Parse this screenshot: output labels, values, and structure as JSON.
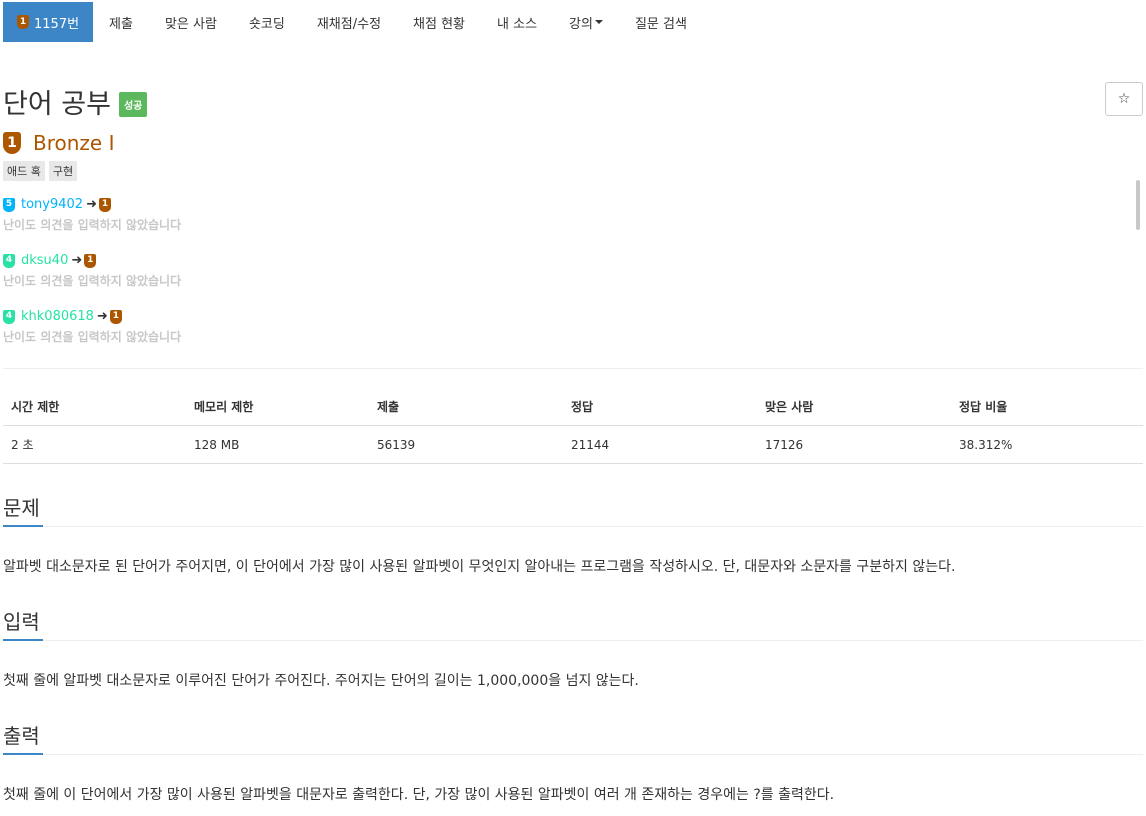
{
  "nav": {
    "problem_id": "1157번",
    "items": [
      "제출",
      "맞은 사람",
      "숏코딩",
      "재채점/수정",
      "채점 현황",
      "내 소스",
      "강의",
      "질문 검색"
    ]
  },
  "problem": {
    "title": "단어 공부",
    "result_label": "성공",
    "star": "☆",
    "tier_num": "1",
    "tier_name": "Bronze I",
    "tags": [
      "애드 혹",
      "구현"
    ]
  },
  "opinions": [
    {
      "from_tier": "5",
      "user": "tony9402",
      "to_tier": "1",
      "text": "난이도 의견을 입력하지 않았습니다"
    },
    {
      "from_tier": "4",
      "user": "dksu40",
      "to_tier": "1",
      "text": "난이도 의견을 입력하지 않았습니다"
    },
    {
      "from_tier": "4",
      "user": "khk080618",
      "to_tier": "1",
      "text": "난이도 의견을 입력하지 않았습니다"
    }
  ],
  "stats": {
    "headers": [
      "시간 제한",
      "메모리 제한",
      "제출",
      "정답",
      "맞은 사람",
      "정답 비율"
    ],
    "values": [
      "2 초",
      "128 MB",
      "56139",
      "21144",
      "17126",
      "38.312%"
    ]
  },
  "sections": [
    {
      "title": "문제",
      "body": "알파벳 대소문자로 된 단어가 주어지면, 이 단어에서 가장 많이 사용된 알파벳이 무엇인지 알아내는 프로그램을 작성하시오. 단, 대문자와 소문자를 구분하지 않는다."
    },
    {
      "title": "입력",
      "body": "첫째 줄에 알파벳 대소문자로 이루어진 단어가 주어진다. 주어지는 단어의 길이는 1,000,000을 넘지 않는다."
    },
    {
      "title": "출력",
      "body": "첫째 줄에 이 단어에서 가장 많이 사용된 알파벳을 대문자로 출력한다. 단, 가장 많이 사용된 알파벳이 여러 개 존재하는 경우에는 ?를 출력한다."
    }
  ]
}
